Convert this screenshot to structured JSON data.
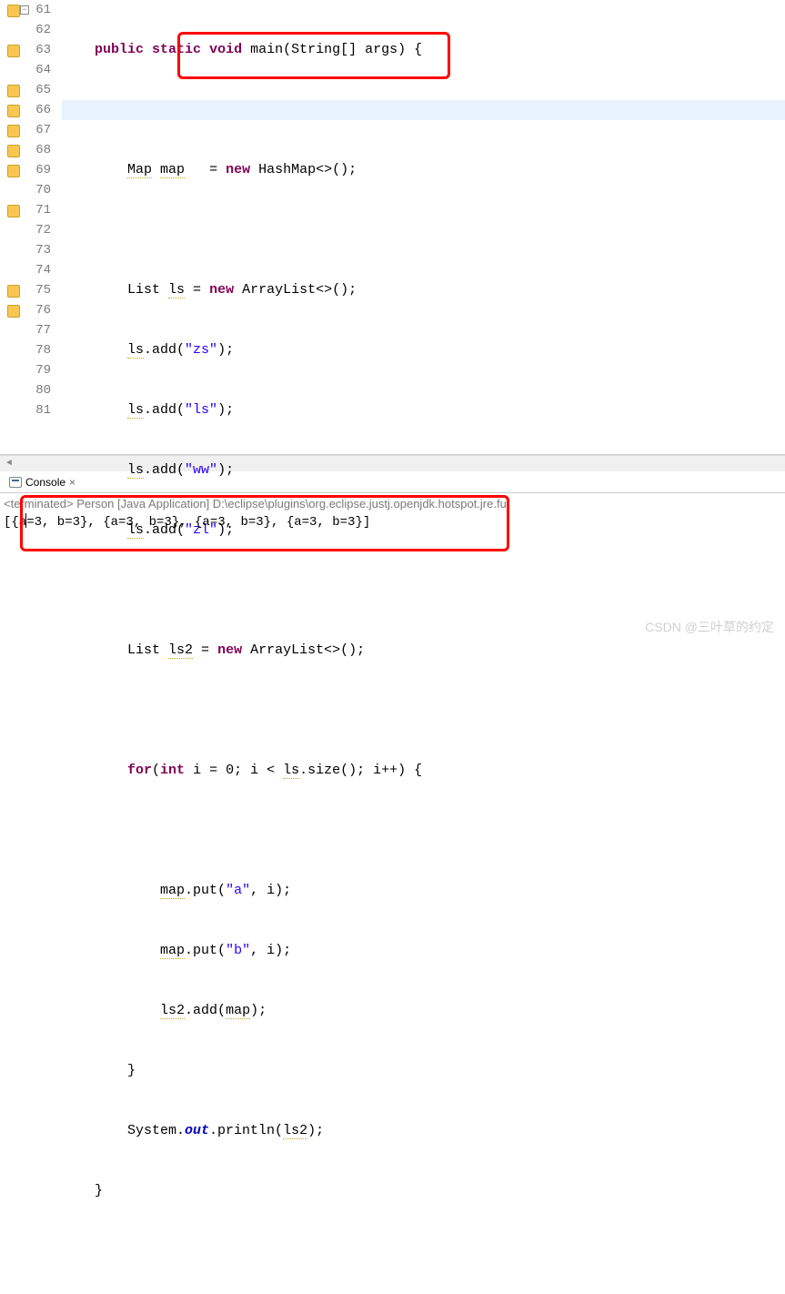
{
  "gutter": {
    "lines": [
      {
        "num": "61",
        "warn": true,
        "fold": true
      },
      {
        "num": "62",
        "warn": false,
        "fold": false
      },
      {
        "num": "63",
        "warn": true,
        "fold": false
      },
      {
        "num": "64",
        "warn": false,
        "fold": false
      },
      {
        "num": "65",
        "warn": true,
        "fold": false
      },
      {
        "num": "66",
        "warn": true,
        "fold": false
      },
      {
        "num": "67",
        "warn": true,
        "fold": false
      },
      {
        "num": "68",
        "warn": true,
        "fold": false
      },
      {
        "num": "69",
        "warn": true,
        "fold": false
      },
      {
        "num": "70",
        "warn": false,
        "fold": false
      },
      {
        "num": "71",
        "warn": true,
        "fold": false
      },
      {
        "num": "72",
        "warn": false,
        "fold": false
      },
      {
        "num": "73",
        "warn": false,
        "fold": false
      },
      {
        "num": "74",
        "warn": false,
        "fold": false
      },
      {
        "num": "75",
        "warn": true,
        "fold": false
      },
      {
        "num": "76",
        "warn": true,
        "fold": false
      },
      {
        "num": "77",
        "warn": false,
        "fold": false
      },
      {
        "num": "78",
        "warn": false,
        "fold": false
      },
      {
        "num": "79",
        "warn": false,
        "fold": false
      },
      {
        "num": "80",
        "warn": false,
        "fold": false
      },
      {
        "num": "81",
        "warn": false,
        "fold": false
      }
    ]
  },
  "code": {
    "l61": {
      "kw1": "public",
      "kw2": "static",
      "kw3": "void",
      "name": " main(String[] args) {"
    },
    "l63": {
      "t1": "        ",
      "type": "Map",
      "t2": " ",
      "var": "map",
      "t3": "   = ",
      "kw": "new",
      "t4": " HashMap<>();"
    },
    "l65": {
      "t1": "        List ",
      "var": "ls",
      "t2": " = ",
      "kw": "new",
      "t3": " ArrayList<>();"
    },
    "l66": {
      "t1": "        ",
      "var": "ls",
      "t2": ".add(",
      "str": "\"zs\"",
      "t3": ");"
    },
    "l67": {
      "t1": "        ",
      "var": "ls",
      "t2": ".add(",
      "str": "\"ls\"",
      "t3": ");"
    },
    "l68": {
      "t1": "        ",
      "var": "ls",
      "t2": ".add(",
      "str": "\"ww\"",
      "t3": ");"
    },
    "l69": {
      "t1": "        ",
      "var": "ls",
      "t2": ".add(",
      "str": "\"zl\"",
      "t3": ");"
    },
    "l71": {
      "t1": "        List ",
      "var": "ls2",
      "t2": " = ",
      "kw": "new",
      "t3": " ArrayList<>();"
    },
    "l73": {
      "t1": "        ",
      "kw1": "for",
      "t2": "(",
      "kw2": "int",
      "t3": " i = 0; i < ",
      "var": "ls",
      "t4": ".size(); i++) {"
    },
    "l75": {
      "t1": "            ",
      "var": "map",
      "t2": ".put(",
      "str": "\"a\"",
      "t3": ", i);"
    },
    "l76": {
      "t1": "            ",
      "var": "map",
      "t2": ".put(",
      "str": "\"b\"",
      "t3": ", i);"
    },
    "l77": {
      "t1": "            ",
      "var1": "ls2",
      "t2": ".add(",
      "var2": "map",
      "t3": ");"
    },
    "l78": {
      "t1": "        }"
    },
    "l79": {
      "t1": "        System.",
      "out": "out",
      "t2": ".println(",
      "var": "ls2",
      "t3": ");"
    },
    "l80": {
      "t1": "    }"
    }
  },
  "console": {
    "tab_label": "Console",
    "status": "<terminated> Person [Java Application] D:\\eclipse\\plugins\\org.eclipse.justj.openjdk.hotspot.jre.ful",
    "output": "[{a=3, b=3}, {a=3, b=3}, {a=3, b=3}, {a=3, b=3}]"
  },
  "watermark": "CSDN @三叶草的约定",
  "scroll": {
    "left": "◄"
  }
}
